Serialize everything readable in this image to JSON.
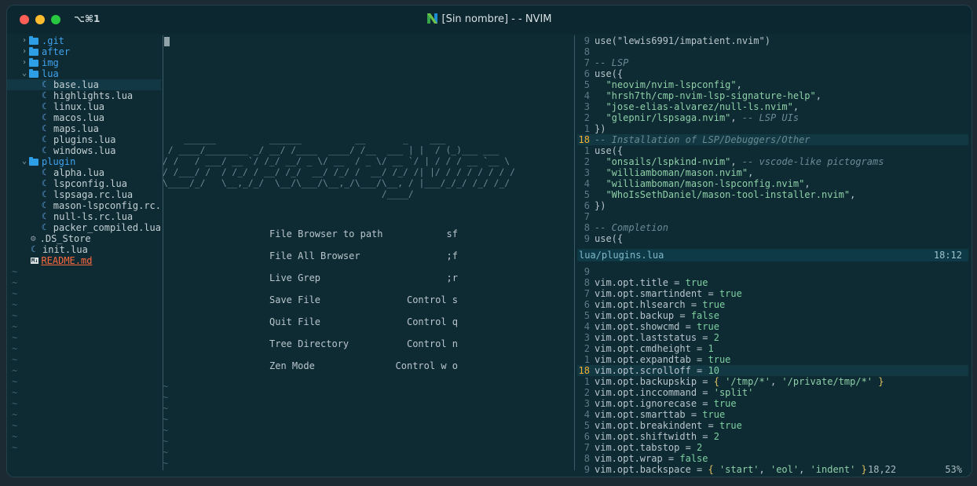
{
  "window": {
    "shortcut": "⌥⌘1",
    "title": "[Sin nombre] - - NVIM"
  },
  "explorer": {
    "items": [
      {
        "type": "dir",
        "open": false,
        "name": ".git"
      },
      {
        "type": "dir",
        "open": false,
        "name": "after"
      },
      {
        "type": "dir",
        "open": false,
        "name": "img"
      },
      {
        "type": "dir",
        "open": true,
        "name": "lua"
      },
      {
        "type": "file",
        "icon": "lua",
        "name": "base.lua",
        "depth": 1,
        "selected": true
      },
      {
        "type": "file",
        "icon": "lua",
        "name": "highlights.lua",
        "depth": 1
      },
      {
        "type": "file",
        "icon": "lua",
        "name": "linux.lua",
        "depth": 1
      },
      {
        "type": "file",
        "icon": "lua",
        "name": "macos.lua",
        "depth": 1
      },
      {
        "type": "file",
        "icon": "lua",
        "name": "maps.lua",
        "depth": 1
      },
      {
        "type": "file",
        "icon": "lua",
        "name": "plugins.lua",
        "depth": 1
      },
      {
        "type": "file",
        "icon": "lua",
        "name": "windows.lua",
        "depth": 1
      },
      {
        "type": "dir",
        "open": true,
        "name": "plugin"
      },
      {
        "type": "file",
        "icon": "lua",
        "name": "alpha.lua",
        "depth": 1
      },
      {
        "type": "file",
        "icon": "lua",
        "name": "lspconfig.lua",
        "depth": 1
      },
      {
        "type": "file",
        "icon": "lua",
        "name": "lspsaga.rc.lua",
        "depth": 1
      },
      {
        "type": "file",
        "icon": "lua",
        "name": "mason-lspconfig.rc.",
        "depth": 1
      },
      {
        "type": "file",
        "icon": "lua",
        "name": "null-ls.rc.lua",
        "depth": 1
      },
      {
        "type": "file",
        "icon": "lua",
        "name": "packer_compiled.lua",
        "depth": 1
      },
      {
        "type": "file",
        "icon": "gear",
        "name": ".DS_Store",
        "depth": 0
      },
      {
        "type": "file",
        "icon": "lua",
        "name": "init.lua",
        "depth": 0
      },
      {
        "type": "file",
        "icon": "md",
        "name": "README.md",
        "depth": 0,
        "special": "readme"
      }
    ],
    "tilde_count": 17
  },
  "dashboard": {
    "ascii": [
      "    ______          ______          __       _    ___",
      " / ____/________ _/ __/ /____  ____/ /__  ___ | |  / (_)___ ___",
      "/ /   / ___/ __ `/ /_/ __/ _ \\/ __  / _ \\/ __ `/ | / / / __ `__ \\",
      "/ /___/ /  / /_/ / __/ /_/  __/ /_/ /  __/ /_/ /| |/ / / / / / / /",
      "\\____/_/   \\__,_/_/  \\__/\\___/\\__,_/\\___/\\__, / |___/_/_/ /_/ /_/",
      "                                         /____/"
    ],
    "menu": [
      {
        "label": "File Browser to path",
        "key": "sf"
      },
      {
        "label": "File All Browser",
        "key": ";f"
      },
      {
        "label": "Live Grep",
        "key": ";r"
      },
      {
        "label": "Save File",
        "key": "Control s"
      },
      {
        "label": "Quit File",
        "key": "Control q"
      },
      {
        "label": "Tree Directory",
        "key": "Control n"
      },
      {
        "label": "Zen Mode",
        "key": "Control w  o"
      }
    ],
    "tilde": "~"
  },
  "pane_top": {
    "lines": [
      {
        "n": "9",
        "code": [
          [
            "",
            "use(\"lewis6991/impatient.nvim\")"
          ]
        ]
      },
      {
        "n": "8",
        "code": [
          [
            "",
            ""
          ]
        ]
      },
      {
        "n": "7",
        "code": [
          [
            "c",
            "-- LSP"
          ]
        ]
      },
      {
        "n": "6",
        "code": [
          [
            "",
            "use({"
          ]
        ]
      },
      {
        "n": "5",
        "code": [
          [
            "s",
            "  \"neovim/nvim-lspconfig\""
          ],
          [
            "",
            ","
          ]
        ]
      },
      {
        "n": "4",
        "code": [
          [
            "s",
            "  \"hrsh7th/cmp-nvim-lsp-signature-help\""
          ],
          [
            "",
            ","
          ]
        ]
      },
      {
        "n": "3",
        "code": [
          [
            "s",
            "  \"jose-elias-alvarez/null-ls.nvim\""
          ],
          [
            "",
            ","
          ]
        ]
      },
      {
        "n": "2",
        "code": [
          [
            "s",
            "  \"glepnir/lspsaga.nvim\""
          ],
          [
            "",
            ", "
          ],
          [
            "c",
            "-- LSP UIs"
          ]
        ]
      },
      {
        "n": "1",
        "code": [
          [
            "",
            "})"
          ]
        ]
      },
      {
        "n": "18",
        "cur": true,
        "code": [
          [
            "c",
            "-- Installation of LSP/Debuggers/Other"
          ]
        ]
      },
      {
        "n": "1",
        "code": [
          [
            "",
            "use({"
          ]
        ]
      },
      {
        "n": "2",
        "code": [
          [
            "s",
            "  \"onsails/lspkind-nvim\""
          ],
          [
            "",
            ", "
          ],
          [
            "c",
            "-- vscode-like pictograms"
          ]
        ]
      },
      {
        "n": "3",
        "code": [
          [
            "s",
            "  \"williamboman/mason.nvim\""
          ],
          [
            "",
            ","
          ]
        ]
      },
      {
        "n": "4",
        "code": [
          [
            "s",
            "  \"williamboman/mason-lspconfig.nvim\""
          ],
          [
            "",
            ","
          ]
        ]
      },
      {
        "n": "5",
        "code": [
          [
            "s",
            "  \"WhoIsSethDaniel/mason-tool-installer.nvim\""
          ],
          [
            "",
            ","
          ]
        ]
      },
      {
        "n": "6",
        "code": [
          [
            "",
            "})"
          ]
        ]
      },
      {
        "n": "7",
        "code": [
          [
            "",
            ""
          ]
        ]
      },
      {
        "n": "8",
        "code": [
          [
            "c",
            "-- Completion"
          ]
        ]
      },
      {
        "n": "9",
        "code": [
          [
            "",
            "use({"
          ]
        ]
      }
    ]
  },
  "statusline": {
    "file": "lua/plugins.lua",
    "pos": "18:12"
  },
  "pane_bottom": {
    "lines": [
      {
        "n": "9",
        "code": [
          [
            "",
            ""
          ]
        ]
      },
      {
        "n": "8",
        "code": [
          [
            "",
            "vim.opt.title = "
          ],
          [
            "n",
            "true"
          ]
        ]
      },
      {
        "n": "7",
        "code": [
          [
            "",
            "vim.opt.smartindent = "
          ],
          [
            "n",
            "true"
          ]
        ]
      },
      {
        "n": "6",
        "code": [
          [
            "",
            "vim.opt.hlsearch = "
          ],
          [
            "n",
            "true"
          ]
        ]
      },
      {
        "n": "5",
        "code": [
          [
            "",
            "vim.opt.backup = "
          ],
          [
            "n",
            "false"
          ]
        ]
      },
      {
        "n": "4",
        "code": [
          [
            "",
            "vim.opt.showcmd = "
          ],
          [
            "n",
            "true"
          ]
        ]
      },
      {
        "n": "3",
        "code": [
          [
            "",
            "vim.opt.laststatus = "
          ],
          [
            "n",
            "2"
          ]
        ]
      },
      {
        "n": "2",
        "code": [
          [
            "",
            "vim.opt.cmdheight = "
          ],
          [
            "n",
            "1"
          ]
        ]
      },
      {
        "n": "1",
        "code": [
          [
            "",
            "vim.opt.expandtab = "
          ],
          [
            "n",
            "true"
          ]
        ]
      },
      {
        "n": "18",
        "cur": true,
        "code": [
          [
            "",
            "vim.opt.scrolloff = "
          ],
          [
            "n",
            "10"
          ]
        ]
      },
      {
        "n": "1",
        "code": [
          [
            "",
            "vim.opt.backupskip = "
          ],
          [
            "k",
            "{ "
          ],
          [
            "s",
            "'/tmp/*'"
          ],
          [
            "",
            ", "
          ],
          [
            "s",
            "'/private/tmp/*'"
          ],
          [
            "k",
            " }"
          ]
        ]
      },
      {
        "n": "2",
        "code": [
          [
            "",
            "vim.opt.inccommand = "
          ],
          [
            "s",
            "'split'"
          ]
        ]
      },
      {
        "n": "3",
        "code": [
          [
            "",
            "vim.opt.ignorecase = "
          ],
          [
            "n",
            "true"
          ]
        ]
      },
      {
        "n": "4",
        "code": [
          [
            "",
            "vim.opt.smarttab = "
          ],
          [
            "n",
            "true"
          ]
        ]
      },
      {
        "n": "5",
        "code": [
          [
            "",
            "vim.opt.breakindent = "
          ],
          [
            "n",
            "true"
          ]
        ]
      },
      {
        "n": "6",
        "code": [
          [
            "",
            "vim.opt.shiftwidth = "
          ],
          [
            "n",
            "2"
          ]
        ]
      },
      {
        "n": "7",
        "code": [
          [
            "",
            "vim.opt.tabstop = "
          ],
          [
            "n",
            "2"
          ]
        ]
      },
      {
        "n": "8",
        "code": [
          [
            "",
            "vim.opt.wrap = "
          ],
          [
            "n",
            "false"
          ]
        ]
      },
      {
        "n": "9",
        "code": [
          [
            "",
            "vim.opt.backspace = "
          ],
          [
            "k",
            "{ "
          ],
          [
            "s",
            "'start'"
          ],
          [
            "",
            ", "
          ],
          [
            "s",
            "'eol'"
          ],
          [
            "",
            ", "
          ],
          [
            "s",
            "'indent'"
          ],
          [
            "k",
            " }"
          ]
        ]
      }
    ]
  },
  "bottom_status": {
    "pos": "18,22",
    "percent": "53%"
  }
}
